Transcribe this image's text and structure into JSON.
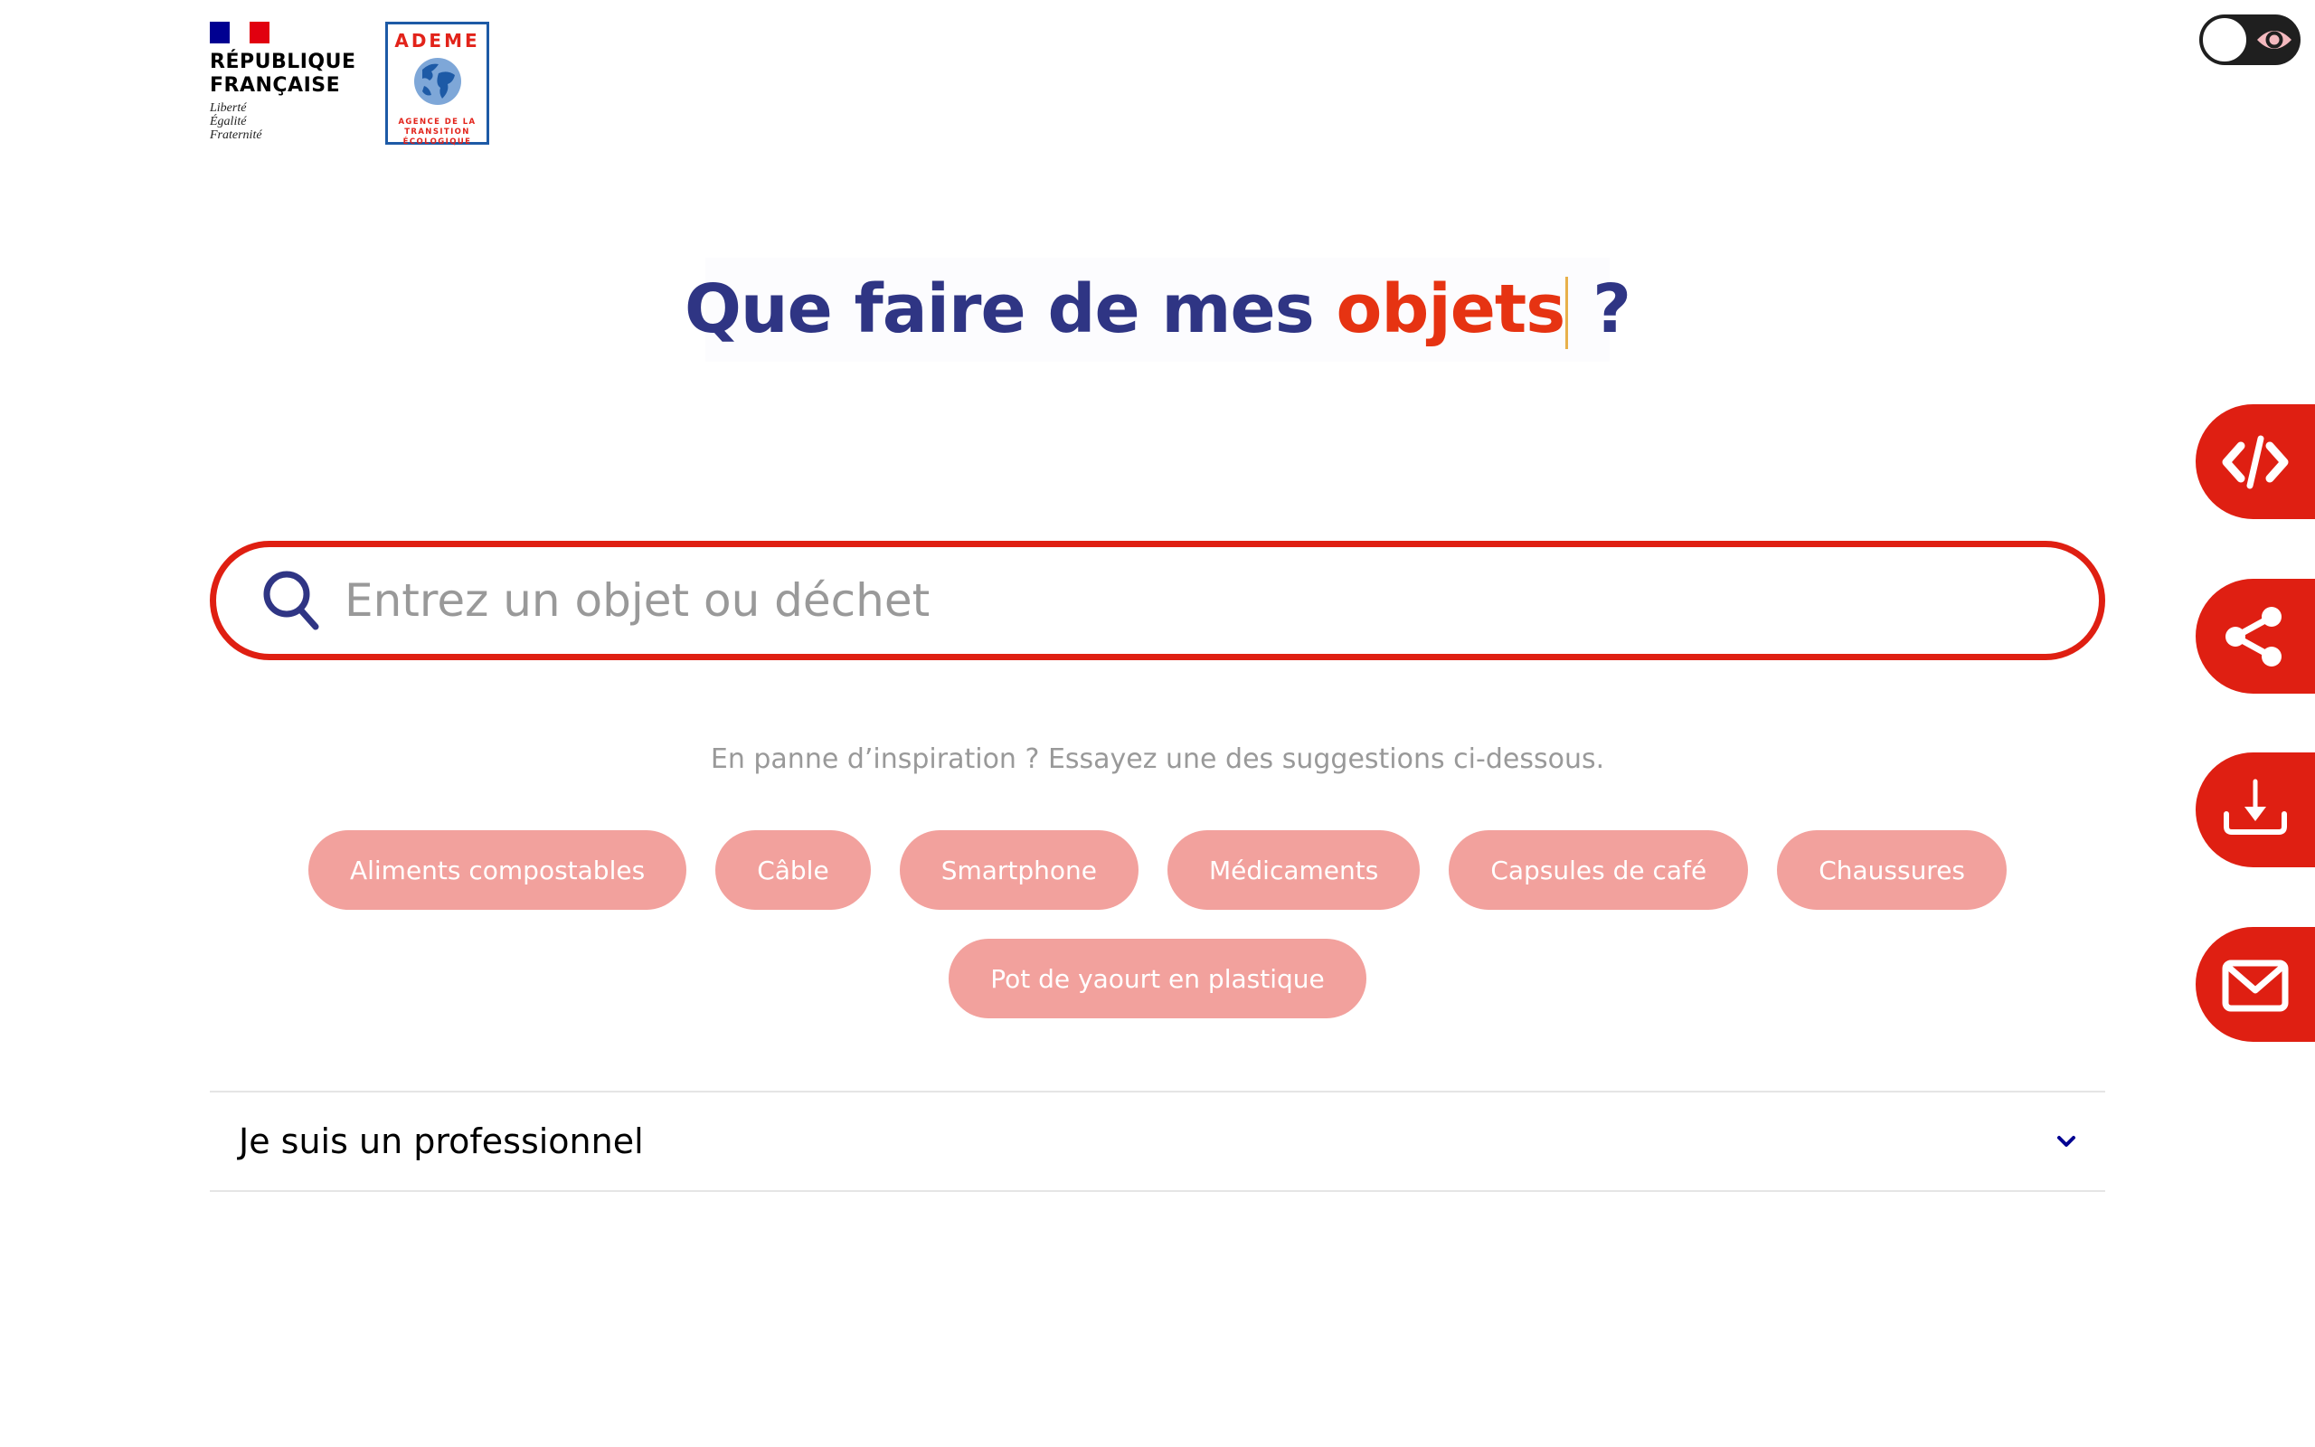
{
  "header": {
    "republique_logo": {
      "name_line1": "RÉPUBLIQUE",
      "name_line2": "FRANÇAISE",
      "motto": [
        "Liberté",
        "Égalité",
        "Fraternité"
      ],
      "flag_colors": [
        "#000091",
        "#ffffff",
        "#e1000f"
      ]
    },
    "ademe_logo": {
      "title": "ADEME",
      "subtitle": [
        "AGENCE DE LA",
        "TRANSITION",
        "ÉCOLOGIQUE"
      ]
    },
    "contrast_toggle": {
      "icon": "eye-icon",
      "state": "off"
    }
  },
  "hero": {
    "title_prefix": "Que faire de mes ",
    "title_accent": "objets",
    "title_suffix": " ?"
  },
  "search": {
    "placeholder": "Entrez un objet ou déchet",
    "value": "",
    "icon": "search-icon"
  },
  "suggestions": {
    "hint": "En panne d’inspiration ? Essayez une des suggestions ci-dessous.",
    "row1": [
      "Aliments compostables",
      "Câble",
      "Smartphone",
      "Médicaments",
      "Capsules de café",
      "Chaussures"
    ],
    "row2": [
      "Pot de yaourt en plastique"
    ]
  },
  "accordion": {
    "label": "Je suis un professionnel",
    "expanded": false
  },
  "side_actions": [
    {
      "name": "embed",
      "icon": "code-icon"
    },
    {
      "name": "share",
      "icon": "share-icon"
    },
    {
      "name": "download",
      "icon": "download-icon"
    },
    {
      "name": "email",
      "icon": "mail-icon"
    }
  ],
  "colors": {
    "brand_red": "#df1f12",
    "brand_blue": "#2f3584",
    "chip_bg": "#f2a19d",
    "hint_text": "#999999"
  }
}
